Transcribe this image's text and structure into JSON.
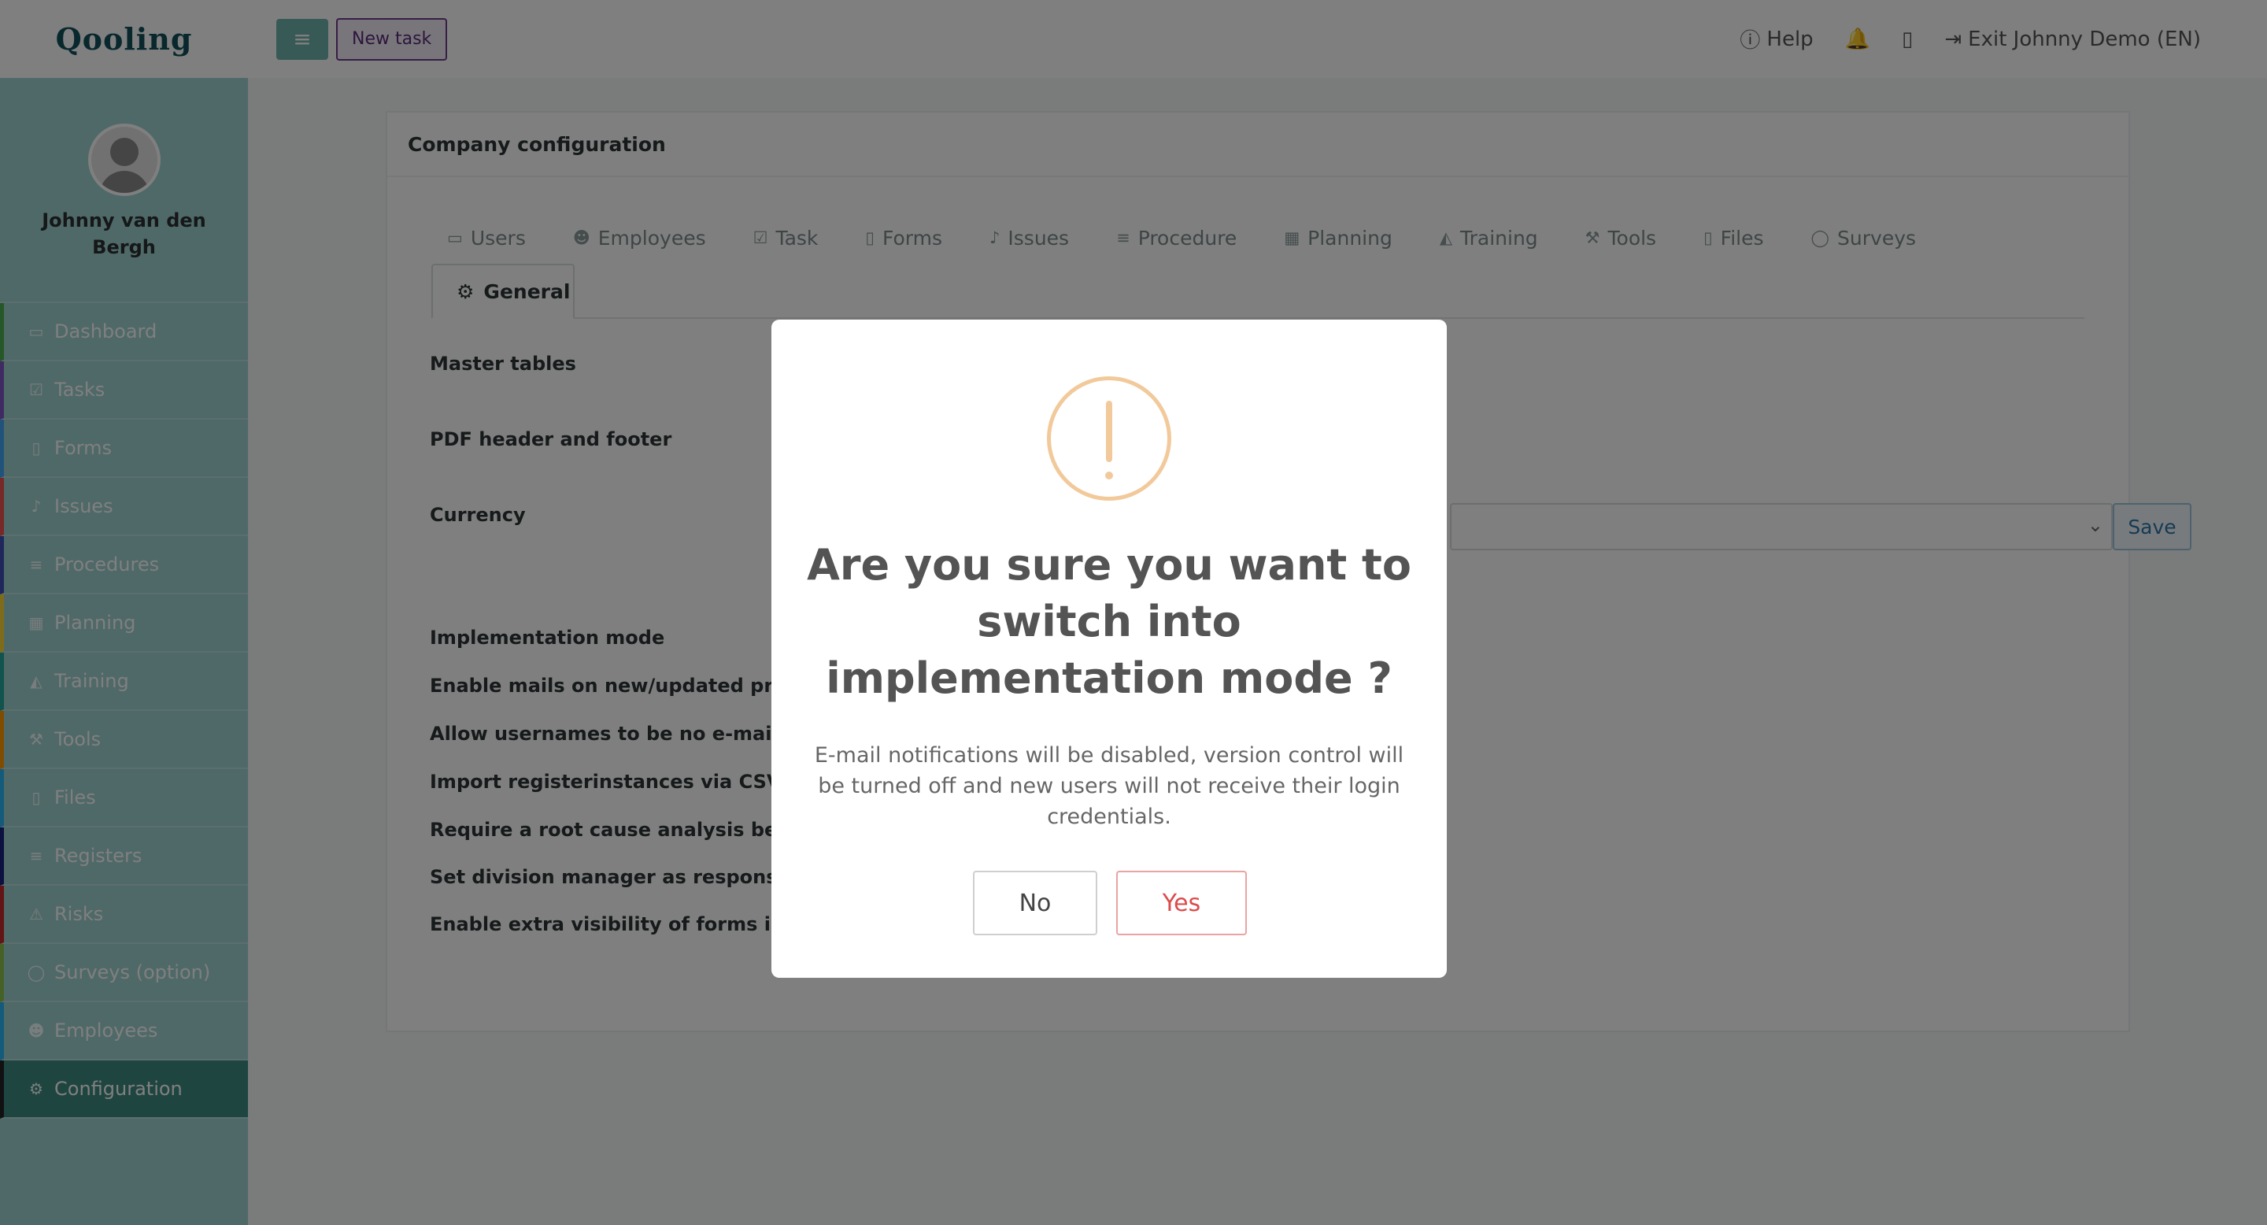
{
  "app": {
    "brand": "Qooling"
  },
  "profile": {
    "name": "Johnny van den Bergh"
  },
  "sidebar": {
    "items": [
      {
        "label": "Dashboard",
        "icon": "monitor-icon",
        "accent": "#4caf50"
      },
      {
        "label": "Tasks",
        "icon": "check-square-icon",
        "accent": "#7e57c2"
      },
      {
        "label": "Forms",
        "icon": "document-icon",
        "accent": "#42a5f5"
      },
      {
        "label": "Issues",
        "icon": "bell-icon",
        "accent": "#ef5350"
      },
      {
        "label": "Procedures",
        "icon": "list-icon",
        "accent": "#3f51b5"
      },
      {
        "label": "Planning",
        "icon": "calendar-icon",
        "accent": "#fdd835"
      },
      {
        "label": "Training",
        "icon": "graduation-cap-icon",
        "accent": "#26a69a"
      },
      {
        "label": "Tools",
        "icon": "wrench-icon",
        "accent": "#ff9800"
      },
      {
        "label": "Files",
        "icon": "file-icon",
        "accent": "#29b6f6"
      },
      {
        "label": "Registers",
        "icon": "list-icon",
        "accent": "#1a237e"
      },
      {
        "label": "Risks",
        "icon": "warning-icon",
        "accent": "#c62828"
      },
      {
        "label": "Surveys (option)",
        "icon": "chat-icon",
        "accent": "#8bc34a"
      },
      {
        "label": "Employees",
        "icon": "users-icon",
        "accent": "#29b6f6"
      },
      {
        "label": "Configuration",
        "icon": "gear-icon",
        "accent": "#222222"
      }
    ]
  },
  "topbar": {
    "new_task": "New task",
    "help": "Help",
    "exit": "Exit Johnny Demo (EN)"
  },
  "panel": {
    "title": "Company configuration",
    "tabs": [
      {
        "label": "Users",
        "icon": "id-card-icon"
      },
      {
        "label": "Employees",
        "icon": "users-icon"
      },
      {
        "label": "Task",
        "icon": "check-square-icon"
      },
      {
        "label": "Forms",
        "icon": "document-icon"
      },
      {
        "label": "Issues",
        "icon": "bell-icon"
      },
      {
        "label": "Procedure",
        "icon": "list-icon"
      },
      {
        "label": "Planning",
        "icon": "calendar-icon"
      },
      {
        "label": "Training",
        "icon": "graduation-cap-icon"
      },
      {
        "label": "Tools",
        "icon": "wrench-icon"
      },
      {
        "label": "Files",
        "icon": "file-icon"
      },
      {
        "label": "Surveys",
        "icon": "chat-icon"
      }
    ],
    "active_tab": "General",
    "settings": [
      "Master tables",
      "PDF header and footer",
      "Currency",
      "Implementation mode",
      "Enable mails on new/updated proced",
      "Allow usernames to be no e-mail",
      "Import registerinstances via CSV (BET",
      "Require a root cause analysis before c",
      "Set division manager as responsible f",
      "Enable extra visibility of forms in PDF"
    ],
    "save": "Save"
  },
  "modal": {
    "title": "Are you sure you want to switch into implementation mode ?",
    "text": "E-mail notifications will be disabled, version control will be turned off and new users will not receive their login credentials.",
    "no": "No",
    "yes": "Yes",
    "icon": "exclamation-icon",
    "accent": "#f2c99a",
    "yes_color": "#dd4b4b"
  }
}
